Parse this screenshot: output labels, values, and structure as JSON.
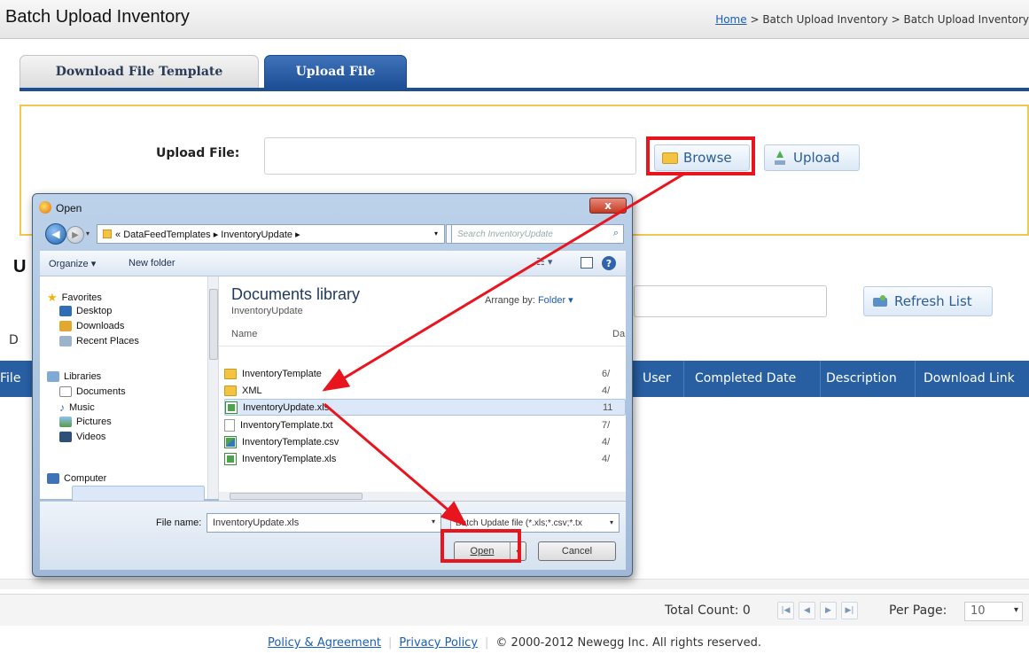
{
  "header": {
    "title": "Batch Upload Inventory",
    "breadcrumb": {
      "home": "Home",
      "sep1": " > ",
      "crumb1": "Batch Upload Inventory",
      "sep2": " > ",
      "crumb2": "Batch Upload Inventory"
    }
  },
  "tabs": [
    {
      "label": "Download File Template",
      "active": false
    },
    {
      "label": "Upload File",
      "active": true
    }
  ],
  "upload": {
    "label": "Upload File:",
    "value": "",
    "browse_label": "Browse",
    "upload_label": "Upload"
  },
  "list": {
    "section_initial": "U",
    "row_label_initial": "D",
    "filter_value": "",
    "refresh_label": "Refresh List",
    "columns": [
      "File",
      "User",
      "Completed Date",
      "Description",
      "Download Link"
    ]
  },
  "pager": {
    "total_label": "Total Count: 0",
    "first": "|◀",
    "prev": "◀",
    "next": "▶",
    "last": "▶|",
    "per_page_label": "Per Page:",
    "per_page_value": "10"
  },
  "footer": {
    "policy": "Policy & Agreement",
    "privacy": "Privacy Policy",
    "copyright": "© 2000-2012  Newegg Inc. All rights reserved."
  },
  "dialog": {
    "title": "Open",
    "close_label": "x",
    "address": {
      "prefix": "«",
      "part1": "DataFeedTemplates",
      "sep": "▸",
      "part2": "InventoryUpdate",
      "sep2": "▸"
    },
    "search_placeholder": "Search InventoryUpdate",
    "toolbar": {
      "organize": "Organize ▾",
      "new_folder": "New folder"
    },
    "nav": {
      "favorites": "Favorites",
      "desktop": "Desktop",
      "downloads": "Downloads",
      "recent": "Recent Places",
      "libraries": "Libraries",
      "documents": "Documents",
      "music": "Music",
      "pictures": "Pictures",
      "videos": "Videos",
      "computer": "Computer"
    },
    "library": {
      "title": "Documents library",
      "subtitle": "InventoryUpdate",
      "arrange_label": "Arrange by:",
      "arrange_value": "Folder ▾"
    },
    "columns": {
      "name": "Name",
      "date": "Da"
    },
    "files": [
      {
        "name": "InventoryTemplate",
        "date": "6/",
        "type": "folder"
      },
      {
        "name": "XML",
        "date": "4/",
        "type": "folder"
      },
      {
        "name": "InventoryUpdate.xls",
        "date": "11",
        "type": "xls",
        "selected": true
      },
      {
        "name": "InventoryTemplate.txt",
        "date": "7/",
        "type": "txt"
      },
      {
        "name": "InventoryTemplate.csv",
        "date": "4/",
        "type": "csv"
      },
      {
        "name": "InventoryTemplate.xls",
        "date": "4/",
        "type": "xls"
      }
    ],
    "file_name_label": "File name:",
    "file_name_value": "InventoryUpdate.xls",
    "file_type_value": "Batch Update file (*.xls;*.csv;*.tx",
    "open_label": "Open",
    "cancel_label": "Cancel"
  },
  "colors": {
    "accent": "#1f4f93",
    "table_header": "#285fa3",
    "panel_border": "#f2c94c",
    "highlight": "#e8151e"
  }
}
